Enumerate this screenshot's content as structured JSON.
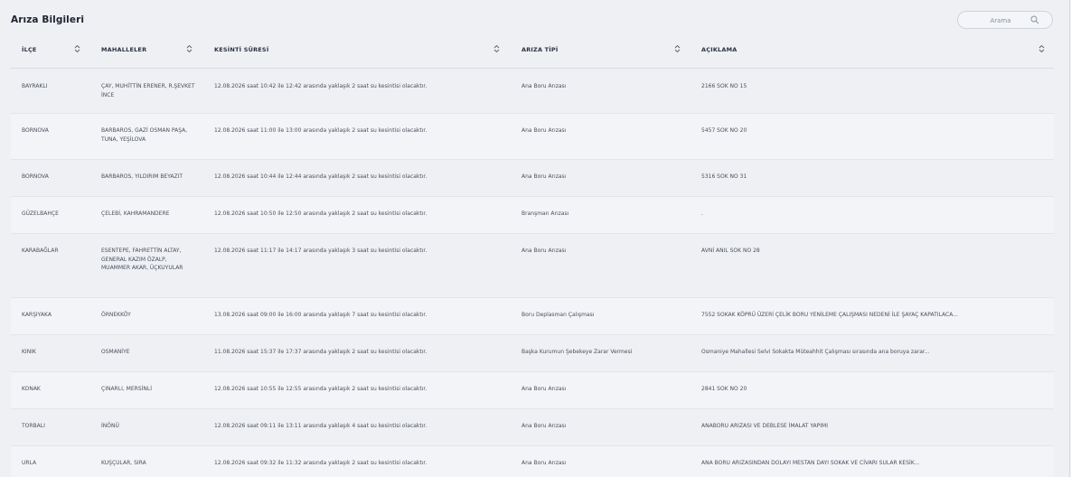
{
  "header": {
    "title": "Arıza Bilgileri",
    "search_placeholder": "Arama"
  },
  "columns": [
    {
      "key": "ilce",
      "label": "İLÇE"
    },
    {
      "key": "mahalleler",
      "label": "MAHALLELER"
    },
    {
      "key": "kesinti",
      "label": "KESİNTİ SÜRESİ"
    },
    {
      "key": "tip",
      "label": "ARIZA TİPİ"
    },
    {
      "key": "aciklama",
      "label": "AÇIKLAMA"
    }
  ],
  "rows": [
    {
      "ilce": "BAYRAKLI",
      "mahalleler": "ÇAY, MUHİTTİN ERENER, R.ŞEVKET İNCE",
      "kesinti": "12.08.2026 saat 10:42 ile 12:42 arasında yaklaşık 2 saat su kesintisi olacaktır.",
      "tip": "Ana Boru Arızası",
      "aciklama": "2166 SOK NO 15"
    },
    {
      "ilce": "BORNOVA",
      "mahalleler": "BARBAROS, GAZİ OSMAN PAŞA, TUNA, YEŞİLOVA",
      "kesinti": "12.08.2026 saat 11:00 ile 13:00 arasında yaklaşık 2 saat su kesintisi olacaktır.",
      "tip": "Ana Boru Arızası",
      "aciklama": "5457 SOK NO 20"
    },
    {
      "ilce": "BORNOVA",
      "mahalleler": "BARBAROS, YILDIRIM BEYAZIT",
      "kesinti": "12.08.2026 saat 10:44 ile 12:44 arasında yaklaşık 2 saat su kesintisi olacaktır.",
      "tip": "Ana Boru Arızası",
      "aciklama": "5316 SOK NO 31"
    },
    {
      "ilce": "GÜZELBAHÇE",
      "mahalleler": "ÇELEBİ, KAHRAMANDERE",
      "kesinti": "12.08.2026 saat 10:50 ile 12:50 arasında yaklaşık 2 saat su kesintisi olacaktır.",
      "tip": "Branşman Arızası",
      "aciklama": "."
    },
    {
      "ilce": "KARABAĞLAR",
      "mahalleler": "ESENTEPE, FAHRETTİN ALTAY, GENERAL KAZIM ÖZALP, MUAMMER AKAR, ÜÇKUYULAR",
      "kesinti": "12.08.2026 saat 11:17 ile 14:17 arasında yaklaşık 3 saat su kesintisi olacaktır.",
      "tip": "Ana Boru Arızası",
      "aciklama": "AVNİ ANIL SOK NO 28"
    },
    {
      "ilce": "KARŞIYAKA",
      "mahalleler": "ÖRNEKKÖY",
      "kesinti": "13.08.2026 saat 09:00 ile 16:00 arasında yaklaşık 7 saat su kesintisi olacaktır.",
      "tip": "Boru Deplasman Çalışması",
      "aciklama": "7552 SOKAK KÖPRÜ ÜZERİ ÇELİK BORU YENİLEME ÇALIŞMASI NEDENİ İLE ŞAYAÇ KAPATILACA..."
    },
    {
      "ilce": "KINIK",
      "mahalleler": "OSMANİYE",
      "kesinti": "11.08.2026 saat 15:37 ile 17:37 arasında yaklaşık 2 saat su kesintisi olacaktır.",
      "tip": "Başka Kurumun Şebekeye Zarar Vermesi",
      "aciklama": "Osmaniye Mahallesi Selvi Sokakta Müteahhit Çalışması sırasında ana boruya zarar..."
    },
    {
      "ilce": "KONAK",
      "mahalleler": "ÇINARLI, MERSİNLİ",
      "kesinti": "12.08.2026 saat 10:55 ile 12:55 arasında yaklaşık 2 saat su kesintisi olacaktır.",
      "tip": "Ana Boru Arızası",
      "aciklama": "2841 SOK NO 20"
    },
    {
      "ilce": "TORBALI",
      "mahalleler": "İNÖNÜ",
      "kesinti": "12.08.2026 saat 09:11 ile 13:11 arasında yaklaşık 4 saat su kesintisi olacaktır.",
      "tip": "Ana Boru Arızası",
      "aciklama": "ANABORU ARIZASI VE DEBLESE İMALAT YAPIMI"
    },
    {
      "ilce": "URLA",
      "mahalleler": "KUŞÇULAR, SIRA",
      "kesinti": "12.08.2026 saat 09:32 ile 11:32 arasında yaklaşık 2 saat su kesintisi olacaktır.",
      "tip": "Ana Boru Arızası",
      "aciklama": "ANA BORU ARIZASINDAN DOLAYI MESTAN DAYI SOKAK VE CİVARI SULAR KESİK..."
    }
  ]
}
